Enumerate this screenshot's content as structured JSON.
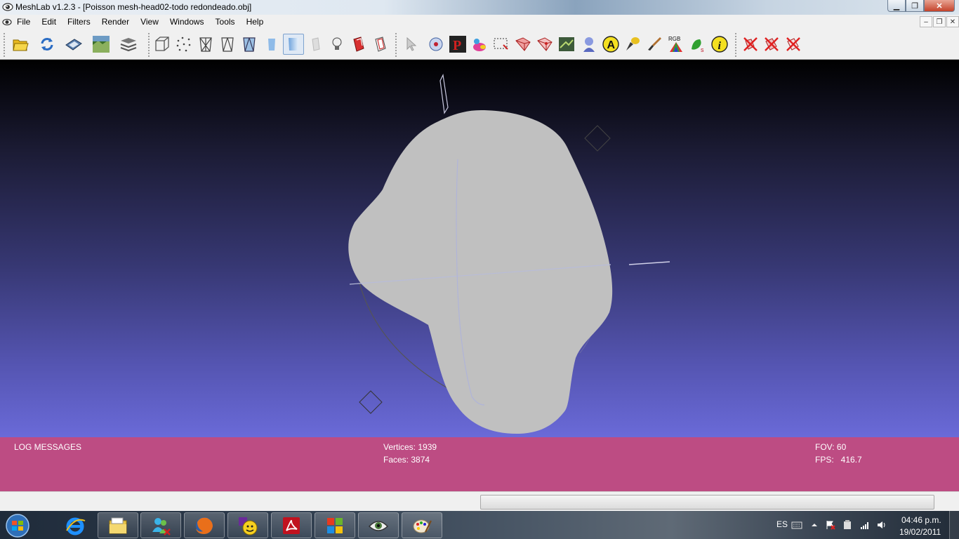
{
  "window": {
    "title": "MeshLab v1.2.3 - [Poisson mesh-head02-todo redondeado.obj]",
    "minimize_glyph": "▁",
    "restore_glyph": "❐",
    "close_glyph": "✕"
  },
  "menubar": {
    "items": [
      "File",
      "Edit",
      "Filters",
      "Render",
      "View",
      "Windows",
      "Tools",
      "Help"
    ],
    "mdi_minimize": "–",
    "mdi_restore": "❐",
    "mdi_close": "✕"
  },
  "toolbar": {
    "groups": [
      [
        "open-icon",
        "reload-icon",
        "save-icon",
        "snapshot-icon",
        "layers-icon"
      ],
      [
        "bounding-box-icon",
        "points-icon",
        "wireframe-icon",
        "hidden-lines-icon",
        "flat-lines-icon",
        "flat-icon",
        "smooth-icon",
        "texture-icon",
        "light-icon",
        "backface-icon",
        "double-side-icon"
      ],
      [
        "manipulator-icon",
        "pick-points-icon",
        "paint-p-icon",
        "color-bunny-icon",
        "select-region-icon",
        "select-faces-icon",
        "select-vertices-icon",
        "align-icon",
        "measure-head-icon",
        "annotate-a-icon",
        "z-paint-icon",
        "brush-icon",
        "rgb-icon",
        "isoparam-icon",
        "info-icon"
      ],
      [
        "delete-selected-icon",
        "delete-faces-icon",
        "delete-vertices-icon"
      ]
    ],
    "active_button": "flat-icon",
    "rgb_label": "RGB",
    "info_label": "i",
    "annotate_label": "A"
  },
  "log": {
    "title": "LOG MESSAGES",
    "vertices": "Vertices: 1939",
    "faces": "Faces: 3874",
    "fov": "FOV: 60",
    "fps": "FPS:   416.7"
  },
  "colors": {
    "log_background": "#bd4c83",
    "mesh": "#c0c0c0",
    "viewport_top": "#000000",
    "viewport_bottom": "#6a6ad8"
  },
  "taskbar": {
    "apps": [
      "internet-explorer-icon",
      "file-explorer-icon",
      "messenger-icon",
      "firefox-icon",
      "yahoo-messenger-icon",
      "acrobat-icon",
      "windows-update-icon",
      "meshlab-eye-icon",
      "paint-icon"
    ],
    "language": "ES",
    "time": "04:46 p.m.",
    "date": "19/02/2011"
  }
}
